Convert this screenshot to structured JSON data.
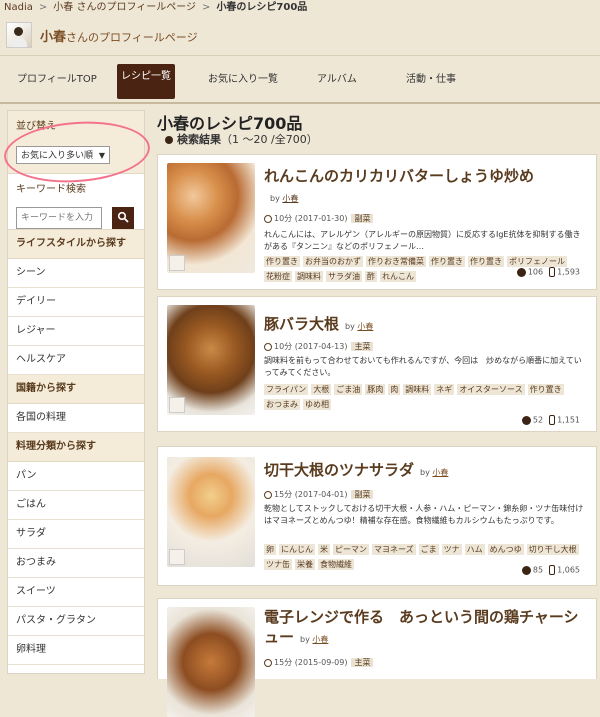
{
  "breadcrumb": [
    "Nadia",
    "小春 さんのプロフィールページ",
    "小春のレシピ700品"
  ],
  "profile": {
    "name": "小春",
    "suffix": "さんのプロフィールページ"
  },
  "tabs": [
    "プロフィールTOP",
    "レシピ一覧",
    "お気に入り一覧",
    "アルバム",
    "活動・仕事"
  ],
  "active_tab": "レシピ一覧",
  "sidebar": {
    "sort_title": "並び替え",
    "sort_value": "お気に入り多い順",
    "keyword_title": "キーワード検索",
    "keyword_placeholder": "キーワードを入力",
    "lifestyle_title": "ライフスタイルから探す",
    "lifestyle_items": [
      "シーン",
      "デイリー",
      "レジャー",
      "ヘルスケア"
    ],
    "country_title": "国籍から探す",
    "country_items": [
      "各国の料理"
    ],
    "category_title": "料理分類から探す",
    "category_items": [
      "パン",
      "ごはん",
      "サラダ",
      "おつまみ",
      "スイーツ",
      "パスタ・グラタン",
      "卵料理"
    ]
  },
  "main": {
    "title": "小春のレシピ700品",
    "sub_label": "検索結果",
    "sub_range": "（1 ～20 /全700）"
  },
  "recipes": [
    {
      "title": "れんこんのカリカリバターしょうゆ炒め",
      "by_label": "by",
      "author": "小春",
      "time": "10分",
      "date": "(2017-01-30)",
      "category": "副菜",
      "desc": "れんこんには、アレルゲン（アレルギーの原因物質）に反応するIgE抗体を抑制する働きがある『タンニン』などのポリフェノール…",
      "tags": [
        "作り置き",
        "お弁当のおかず",
        "作りおき常備菜",
        "作り置き",
        "作り置き",
        "ポリフェノール",
        "花粉症",
        "調味料",
        "サラダ油",
        "酢",
        "れんこん"
      ],
      "likes": "106",
      "clips": "1,593"
    },
    {
      "title": "豚バラ大根",
      "by_label": "by",
      "author": "小春",
      "time": "10分",
      "date": "(2017-04-13)",
      "category": "主菜",
      "desc": "調味料を前もって合わせておいても作れるんですが、今回は　炒めながら順番に加えていってみてください。",
      "tags": [
        "フライパン",
        "大根",
        "ごま油",
        "豚肉",
        "肉",
        "調味料",
        "ネギ",
        "オイスターソース",
        "作り置き",
        "おつまみ",
        "ゆめ相"
      ],
      "likes": "52",
      "clips": "1,151"
    },
    {
      "title": "切干大根のツナサラダ",
      "by_label": "by",
      "author": "小春",
      "time": "15分",
      "date": "(2017-04-01)",
      "category": "副菜",
      "desc": "乾物としてストックしておける切干大根・人参・ハム・ピーマン・錦糸卵・ツナ缶味付けはマヨネーズとめんつゆ！精補な存在感。食物繊維もカルシウムもたっぷりです。",
      "tags": [
        "卵",
        "にんじん",
        "米",
        "ピーマン",
        "マヨネーズ",
        "ごま",
        "ツナ",
        "ハム",
        "めんつゆ",
        "切り干し大根",
        "ツナ缶",
        "栄養",
        "食物繊維"
      ],
      "likes": "85",
      "clips": "1,065"
    },
    {
      "title": "電子レンジで作る　あっという間の鶏チャーシュー",
      "by_label": "by",
      "author": "小春",
      "time": "15分",
      "date": "(2015-09-09)",
      "category": "主菜"
    }
  ]
}
